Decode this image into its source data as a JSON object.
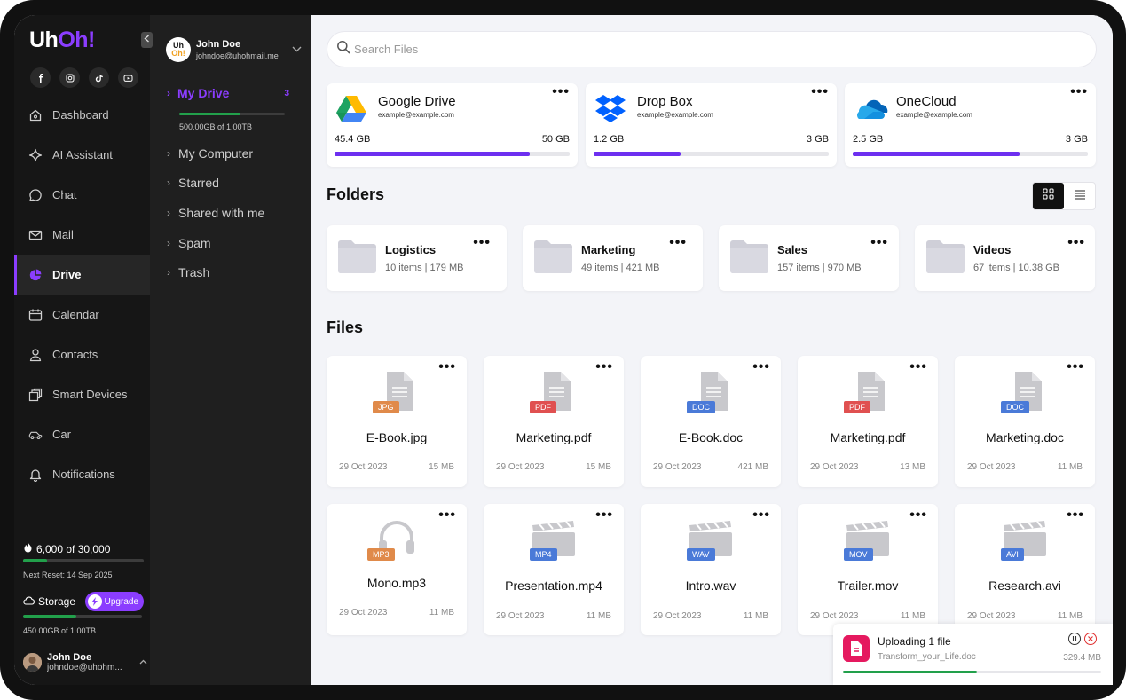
{
  "brand": {
    "logo_part1": "Uh",
    "logo_part2": "Oh!",
    "colors": {
      "accent": "#8b3dff",
      "success": "#22a04b",
      "panel": "#161616"
    }
  },
  "socials": [
    "facebook-icon",
    "instagram-icon",
    "tiktok-icon",
    "youtube-icon"
  ],
  "nav": {
    "items": [
      {
        "label": "Dashboard",
        "icon": "home-icon"
      },
      {
        "label": "AI Assistant",
        "icon": "sparkle-icon"
      },
      {
        "label": "Chat",
        "icon": "chat-icon"
      },
      {
        "label": "Mail",
        "icon": "mail-icon"
      },
      {
        "label": "Drive",
        "icon": "drive-pie-icon",
        "active": true
      },
      {
        "label": "Calendar",
        "icon": "calendar-icon"
      },
      {
        "label": "Contacts",
        "icon": "contact-icon"
      },
      {
        "label": "Smart Devices",
        "icon": "devices-icon"
      },
      {
        "label": "Car",
        "icon": "car-icon"
      },
      {
        "label": "Notifications",
        "icon": "bell-icon"
      }
    ],
    "credits": {
      "value": "6,000 of 30,000",
      "reset": "Next Reset: 14 Sep 2025",
      "fraction": 0.2
    },
    "storage": {
      "label": "Storage",
      "upgrade": "Upgrade",
      "text": "450.00GB of 1.00TB",
      "fraction": 0.45
    },
    "user": {
      "name": "John Doe",
      "email": "johndoe@uhohm..."
    }
  },
  "drive_panel": {
    "user": {
      "avatar_top": "Uh",
      "avatar_bottom": "Oh!",
      "name": "John Doe",
      "email": "johndoe@uhohmail.me"
    },
    "my_drive": {
      "label": "My Drive",
      "count": "3",
      "usage": "500.00GB of 1.00TB",
      "fraction": 0.58
    },
    "items": [
      "My Computer",
      "Starred",
      "Shared with me",
      "Spam",
      "Trash"
    ]
  },
  "main": {
    "search_placeholder": "Search Files",
    "clouds": [
      {
        "name": "Google Drive",
        "email": "example@example.com",
        "used": "45.4 GB",
        "total": "50 GB",
        "fraction": 0.83,
        "icon": "google-drive-icon"
      },
      {
        "name": "Drop Box",
        "email": "example@example.com",
        "used": "1.2 GB",
        "total": "3 GB",
        "fraction": 0.37,
        "icon": "dropbox-icon"
      },
      {
        "name": "OneCloud",
        "email": "example@example.com",
        "used": "2.5 GB",
        "total": "3 GB",
        "fraction": 0.71,
        "icon": "onecloud-icon"
      }
    ],
    "folders_title": "Folders",
    "folders": [
      {
        "name": "Logistics",
        "meta": "10 items  | 179 MB"
      },
      {
        "name": "Marketing",
        "meta": "49 items  | 421 MB"
      },
      {
        "name": "Sales",
        "meta": "157 items  | 970 MB"
      },
      {
        "name": "Videos",
        "meta": "67 items  | 10.38 GB"
      }
    ],
    "files_title": "Files",
    "files": [
      {
        "name": "E-Book.jpg",
        "type": "JPG",
        "kind": "doc",
        "color": "#e08a4a",
        "date": "29 Oct 2023",
        "size": "15 MB"
      },
      {
        "name": "Marketing.pdf",
        "type": "PDF",
        "kind": "doc",
        "color": "#e05050",
        "date": "29 Oct 2023",
        "size": "15 MB"
      },
      {
        "name": "E-Book.doc",
        "type": "DOC",
        "kind": "doc",
        "color": "#4a7ad8",
        "date": "29 Oct 2023",
        "size": "421 MB"
      },
      {
        "name": "Marketing.pdf",
        "type": "PDF",
        "kind": "doc",
        "color": "#e05050",
        "date": "29 Oct 2023",
        "size": "13 MB"
      },
      {
        "name": "Marketing.doc",
        "type": "DOC",
        "kind": "doc",
        "color": "#4a7ad8",
        "date": "29 Oct 2023",
        "size": "11 MB"
      },
      {
        "name": "Mono.mp3",
        "type": "MP3",
        "kind": "audio",
        "color": "#e08a4a",
        "date": "29 Oct 2023",
        "size": "11 MB"
      },
      {
        "name": "Presentation.mp4",
        "type": "MP4",
        "kind": "video",
        "color": "#4a7ad8",
        "date": "29 Oct 2023",
        "size": "11 MB"
      },
      {
        "name": "Intro.wav",
        "type": "WAV",
        "kind": "video",
        "color": "#4a7ad8",
        "date": "29 Oct 2023",
        "size": "11 MB"
      },
      {
        "name": "Trailer.mov",
        "type": "MOV",
        "kind": "video",
        "color": "#4a7ad8",
        "date": "29 Oct 2023",
        "size": "11 MB"
      },
      {
        "name": "Research.avi",
        "type": "AVI",
        "kind": "video",
        "color": "#4a7ad8",
        "date": "29 Oct 2023",
        "size": "11 MB"
      }
    ]
  },
  "upload": {
    "title": "Uploading 1 file",
    "file": "Transform_your_Life.doc",
    "size": "329.4 MB",
    "fraction": 0.52
  }
}
